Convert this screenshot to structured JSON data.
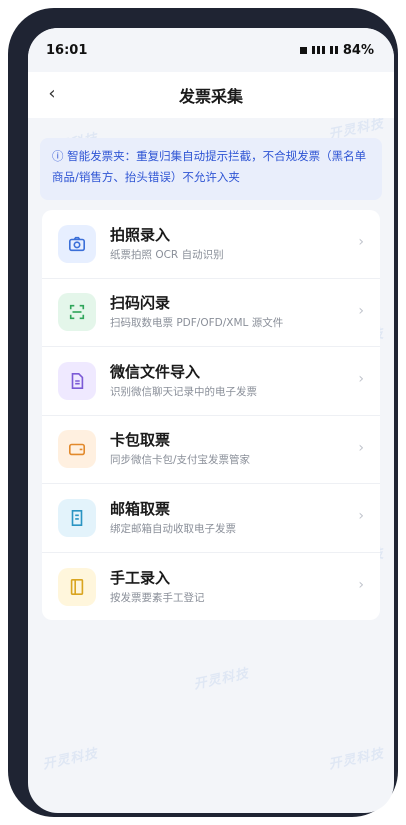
{
  "status": {
    "time": "16:01",
    "battery": "84%"
  },
  "nav": {
    "back_glyph": "‹",
    "title": "发票采集"
  },
  "notice": {
    "text": "ⓘ 智能发票夹：重复归集自动提示拦截，不合规发票（黑名单商品/销售方、抬头错误）不允许入夹"
  },
  "methods": [
    {
      "icon": "camera-icon",
      "title": "拍照录入",
      "subtitle": "纸票拍照 OCR 自动识别",
      "bg": "#e7efff",
      "color": "#3b6fd8"
    },
    {
      "icon": "scan-icon",
      "title": "扫码闪录",
      "subtitle": "扫码取数电票 PDF/OFD/XML 源文件",
      "bg": "#e4f6ea",
      "color": "#2fa55a"
    },
    {
      "icon": "document-icon",
      "title": "微信文件导入",
      "subtitle": "识别微信聊天记录中的电子发票",
      "bg": "#efe9ff",
      "color": "#7b5ad6"
    },
    {
      "icon": "wallet-icon",
      "title": "卡包取票",
      "subtitle": "同步微信卡包/支付宝发票管家",
      "bg": "#fff0e0",
      "color": "#e2892b"
    },
    {
      "icon": "mail-icon",
      "title": "邮箱取票",
      "subtitle": "绑定邮箱自动收取电子发票",
      "bg": "#e3f3fb",
      "color": "#2a94c2"
    },
    {
      "icon": "ledger-icon",
      "title": "手工录入",
      "subtitle": "按发票要素手工登记",
      "bg": "#fff6dc",
      "color": "#d9a520"
    }
  ],
  "chevron": "›",
  "watermark": "开灵科技"
}
